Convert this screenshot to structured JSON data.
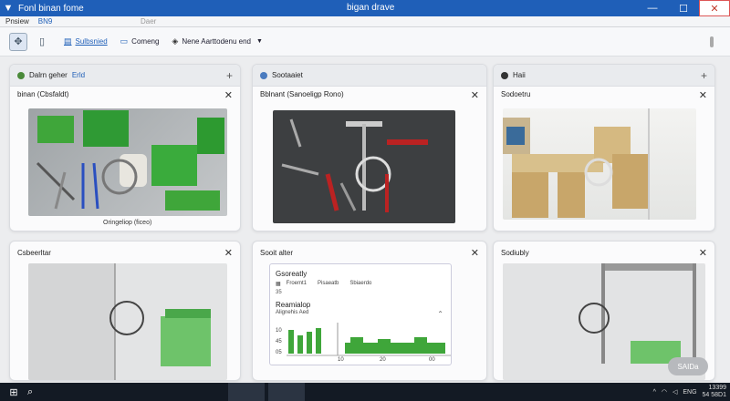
{
  "window": {
    "app_title": "Fonl binan fome",
    "doc_title": "bigan drave",
    "controls": [
      "—",
      "☐",
      "✕"
    ]
  },
  "menu": {
    "items": [
      "Pnsiew",
      "BN9"
    ],
    "dim_item": "Daer"
  },
  "toolbar": {
    "items": [
      {
        "label": "Sulbsnied",
        "icon": "doc-icon"
      },
      {
        "label": "Comeng",
        "icon": "window-icon"
      },
      {
        "label": "Nene Aarttodenu end",
        "icon": "eye-icon"
      }
    ]
  },
  "panels": [
    {
      "tab_label": "Dalrn geher",
      "tab_label2": "Erld",
      "tab_color": "#4a8a3a",
      "header": "binan (Cbsfaldt)",
      "caption": "Oringeliop (ficeo)"
    },
    {
      "tab_label": "Sootaaiet",
      "tab_color": "#4a7bbf",
      "header": "Bblnant (Sanoeligp Rono)"
    },
    {
      "tab_label": "Haii",
      "tab_color": "#333333",
      "header": "Sodoetru"
    },
    {
      "header": "Csbeerltar"
    },
    {
      "header": "Sooit alter"
    },
    {
      "header": "Sodiubly"
    }
  ],
  "card": {
    "title": "Gsoreatly",
    "tabs": [
      "Froemt1",
      "Pisaeatb",
      "Sbiaerdo"
    ],
    "small_value": "35",
    "section": "Reamialop",
    "subtitle": "Alignehis Aed",
    "ylabels": [
      "10",
      "45",
      "05"
    ],
    "xlabels": [
      "10",
      "20",
      "00"
    ]
  },
  "badge": {
    "label": "SAIDa"
  },
  "taskbar": {
    "tray": [
      "ENG"
    ],
    "time": "13399",
    "date": "54 58D1"
  }
}
